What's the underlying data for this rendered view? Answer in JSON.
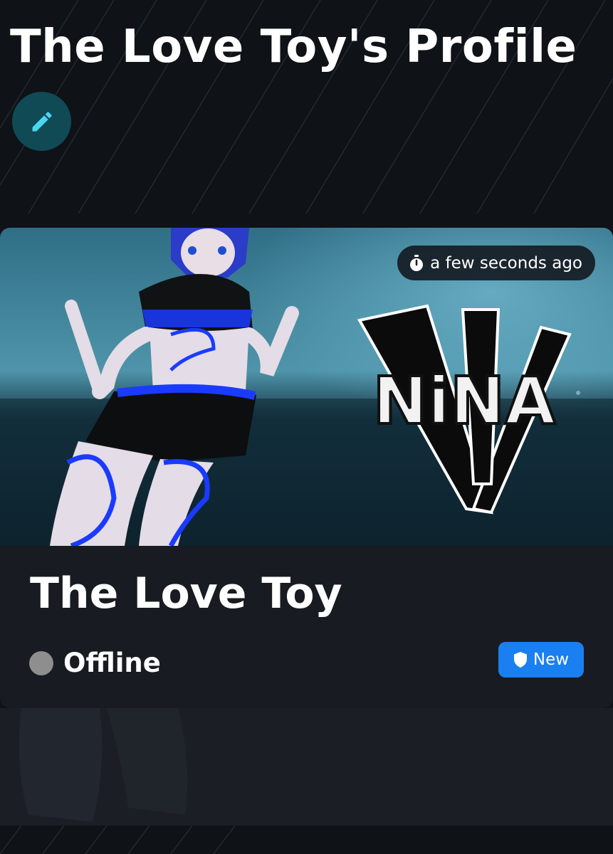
{
  "page": {
    "title": "The Love Toy's Profile",
    "edit_icon": "pencil-icon"
  },
  "profile": {
    "display_name": "The Love Toy",
    "last_seen": "a few seconds ago",
    "timer_icon": "stopwatch-icon",
    "status": {
      "label": "Offline",
      "color": "#8e8e8e"
    },
    "trust_rank": {
      "label": "New",
      "icon": "shield-icon",
      "color": "#1a7ff0"
    },
    "banner": {
      "logo_text": "NiNA",
      "description_hidden": true
    }
  },
  "colors": {
    "page_bg": "#0f1216",
    "card_bg": "#181b21",
    "edit_button_bg": "#0f4a55",
    "accent": "#4ad6f0"
  }
}
